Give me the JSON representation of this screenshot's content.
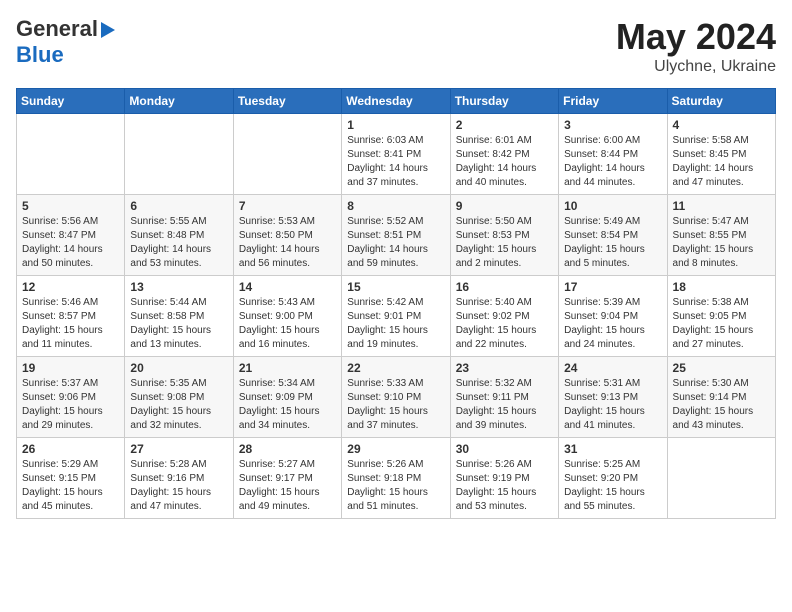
{
  "logo": {
    "general": "General",
    "blue": "Blue"
  },
  "title": {
    "month_year": "May 2024",
    "location": "Ulychne, Ukraine"
  },
  "days_of_week": [
    "Sunday",
    "Monday",
    "Tuesday",
    "Wednesday",
    "Thursday",
    "Friday",
    "Saturday"
  ],
  "weeks": [
    {
      "cells": [
        {
          "day": "",
          "content": ""
        },
        {
          "day": "",
          "content": ""
        },
        {
          "day": "",
          "content": ""
        },
        {
          "day": "1",
          "content": "Sunrise: 6:03 AM\nSunset: 8:41 PM\nDaylight: 14 hours\nand 37 minutes."
        },
        {
          "day": "2",
          "content": "Sunrise: 6:01 AM\nSunset: 8:42 PM\nDaylight: 14 hours\nand 40 minutes."
        },
        {
          "day": "3",
          "content": "Sunrise: 6:00 AM\nSunset: 8:44 PM\nDaylight: 14 hours\nand 44 minutes."
        },
        {
          "day": "4",
          "content": "Sunrise: 5:58 AM\nSunset: 8:45 PM\nDaylight: 14 hours\nand 47 minutes."
        }
      ]
    },
    {
      "cells": [
        {
          "day": "5",
          "content": "Sunrise: 5:56 AM\nSunset: 8:47 PM\nDaylight: 14 hours\nand 50 minutes."
        },
        {
          "day": "6",
          "content": "Sunrise: 5:55 AM\nSunset: 8:48 PM\nDaylight: 14 hours\nand 53 minutes."
        },
        {
          "day": "7",
          "content": "Sunrise: 5:53 AM\nSunset: 8:50 PM\nDaylight: 14 hours\nand 56 minutes."
        },
        {
          "day": "8",
          "content": "Sunrise: 5:52 AM\nSunset: 8:51 PM\nDaylight: 14 hours\nand 59 minutes."
        },
        {
          "day": "9",
          "content": "Sunrise: 5:50 AM\nSunset: 8:53 PM\nDaylight: 15 hours\nand 2 minutes."
        },
        {
          "day": "10",
          "content": "Sunrise: 5:49 AM\nSunset: 8:54 PM\nDaylight: 15 hours\nand 5 minutes."
        },
        {
          "day": "11",
          "content": "Sunrise: 5:47 AM\nSunset: 8:55 PM\nDaylight: 15 hours\nand 8 minutes."
        }
      ]
    },
    {
      "cells": [
        {
          "day": "12",
          "content": "Sunrise: 5:46 AM\nSunset: 8:57 PM\nDaylight: 15 hours\nand 11 minutes."
        },
        {
          "day": "13",
          "content": "Sunrise: 5:44 AM\nSunset: 8:58 PM\nDaylight: 15 hours\nand 13 minutes."
        },
        {
          "day": "14",
          "content": "Sunrise: 5:43 AM\nSunset: 9:00 PM\nDaylight: 15 hours\nand 16 minutes."
        },
        {
          "day": "15",
          "content": "Sunrise: 5:42 AM\nSunset: 9:01 PM\nDaylight: 15 hours\nand 19 minutes."
        },
        {
          "day": "16",
          "content": "Sunrise: 5:40 AM\nSunset: 9:02 PM\nDaylight: 15 hours\nand 22 minutes."
        },
        {
          "day": "17",
          "content": "Sunrise: 5:39 AM\nSunset: 9:04 PM\nDaylight: 15 hours\nand 24 minutes."
        },
        {
          "day": "18",
          "content": "Sunrise: 5:38 AM\nSunset: 9:05 PM\nDaylight: 15 hours\nand 27 minutes."
        }
      ]
    },
    {
      "cells": [
        {
          "day": "19",
          "content": "Sunrise: 5:37 AM\nSunset: 9:06 PM\nDaylight: 15 hours\nand 29 minutes."
        },
        {
          "day": "20",
          "content": "Sunrise: 5:35 AM\nSunset: 9:08 PM\nDaylight: 15 hours\nand 32 minutes."
        },
        {
          "day": "21",
          "content": "Sunrise: 5:34 AM\nSunset: 9:09 PM\nDaylight: 15 hours\nand 34 minutes."
        },
        {
          "day": "22",
          "content": "Sunrise: 5:33 AM\nSunset: 9:10 PM\nDaylight: 15 hours\nand 37 minutes."
        },
        {
          "day": "23",
          "content": "Sunrise: 5:32 AM\nSunset: 9:11 PM\nDaylight: 15 hours\nand 39 minutes."
        },
        {
          "day": "24",
          "content": "Sunrise: 5:31 AM\nSunset: 9:13 PM\nDaylight: 15 hours\nand 41 minutes."
        },
        {
          "day": "25",
          "content": "Sunrise: 5:30 AM\nSunset: 9:14 PM\nDaylight: 15 hours\nand 43 minutes."
        }
      ]
    },
    {
      "cells": [
        {
          "day": "26",
          "content": "Sunrise: 5:29 AM\nSunset: 9:15 PM\nDaylight: 15 hours\nand 45 minutes."
        },
        {
          "day": "27",
          "content": "Sunrise: 5:28 AM\nSunset: 9:16 PM\nDaylight: 15 hours\nand 47 minutes."
        },
        {
          "day": "28",
          "content": "Sunrise: 5:27 AM\nSunset: 9:17 PM\nDaylight: 15 hours\nand 49 minutes."
        },
        {
          "day": "29",
          "content": "Sunrise: 5:26 AM\nSunset: 9:18 PM\nDaylight: 15 hours\nand 51 minutes."
        },
        {
          "day": "30",
          "content": "Sunrise: 5:26 AM\nSunset: 9:19 PM\nDaylight: 15 hours\nand 53 minutes."
        },
        {
          "day": "31",
          "content": "Sunrise: 5:25 AM\nSunset: 9:20 PM\nDaylight: 15 hours\nand 55 minutes."
        },
        {
          "day": "",
          "content": ""
        }
      ]
    }
  ]
}
